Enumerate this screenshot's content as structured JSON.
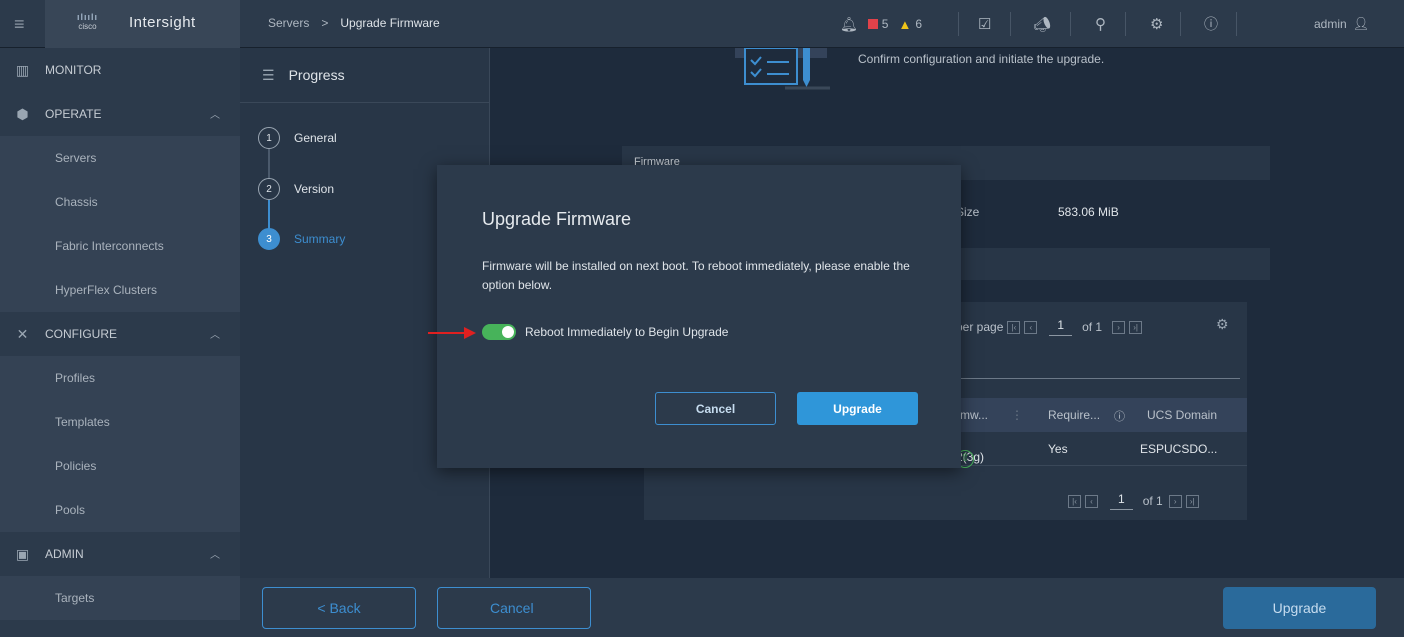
{
  "app": {
    "logo_text": "cisco",
    "title": "Intersight"
  },
  "breadcrumb": {
    "parent": "Servers",
    "separator": ">",
    "current": "Upgrade Firmware"
  },
  "topbar": {
    "critical_count": "5",
    "warning_count": "6",
    "user": "admin"
  },
  "sidebar": {
    "sections": [
      {
        "label": "MONITOR",
        "icon": "monitor-icon"
      },
      {
        "label": "OPERATE",
        "icon": "operate-icon"
      },
      {
        "label": "CONFIGURE",
        "icon": "configure-icon"
      },
      {
        "label": "ADMIN",
        "icon": "admin-icon"
      }
    ],
    "operate_items": [
      "Servers",
      "Chassis",
      "Fabric Interconnects",
      "HyperFlex Clusters"
    ],
    "configure_items": [
      "Profiles",
      "Templates",
      "Policies",
      "Pools"
    ],
    "admin_items": [
      "Targets"
    ]
  },
  "progress": {
    "title": "Progress",
    "steps": [
      {
        "num": "1",
        "label": "General"
      },
      {
        "num": "2",
        "label": "Version"
      },
      {
        "num": "3",
        "label": "Summary"
      }
    ]
  },
  "main": {
    "confirm_text": "Confirm configuration and initiate the upgrade.",
    "firmware_header": "Firmware",
    "size_label": "Size",
    "size_value": "583.06 MiB",
    "per_page_label": "per page",
    "page": "1",
    "of_pages": "of 1",
    "table_headers": [
      "Firmw...",
      "Require...",
      "UCS Domain"
    ],
    "table_row": {
      "firmware": "4.2(3g)",
      "required": "Yes",
      "domain": "ESPUCSDO..."
    }
  },
  "modal": {
    "title": "Upgrade Firmware",
    "message": "Firmware will be installed on next boot. To reboot immediately, please enable the option below.",
    "toggle_label": "Reboot Immediately to Begin Upgrade",
    "toggle_on": true,
    "cancel_label": "Cancel",
    "upgrade_label": "Upgrade"
  },
  "footer": {
    "back_label": "< Back",
    "cancel_label": "Cancel",
    "upgrade_label": "Upgrade"
  },
  "colors": {
    "accent": "#3d8ed0",
    "toggle_on": "#47b35a",
    "critical": "#e1424a",
    "warning": "#f0c419",
    "annotation_arrow": "#e02020"
  }
}
